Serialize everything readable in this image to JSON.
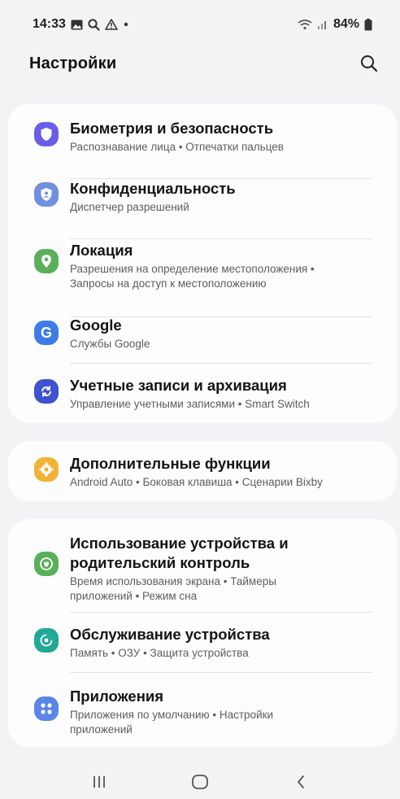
{
  "status_bar": {
    "time": "14:33",
    "battery": "84%",
    "icons_left": [
      "gallery-icon",
      "search-icon",
      "warning-icon",
      "dot-icon"
    ],
    "icons_right": [
      "wifi-icon",
      "signal-icon",
      "battery-icon"
    ]
  },
  "header": {
    "title": "Настройки",
    "search_icon": "search-icon"
  },
  "groups": [
    {
      "items": [
        {
          "title": "Биометрия и безопасность",
          "subtitle": "Распознавание лица • Отпечатки пальцев",
          "icon": "shield-icon",
          "color": "#6a5ee8"
        },
        {
          "title": "Конфиденциальность",
          "subtitle": "Диспетчер разрешений",
          "icon": "privacy-icon",
          "color": "#6f8fe0"
        },
        {
          "title": "Локация",
          "subtitle": "Разрешения на определение местоположения •\nЗапросы на доступ к местоположению",
          "icon": "location-icon",
          "color": "#5aaf5a"
        },
        {
          "title": "Google",
          "subtitle": "Службы Google",
          "icon": "google-icon",
          "color": "#3f7be6"
        },
        {
          "title": "Учетные записи и архивация",
          "subtitle": "Управление учетными записями • Smart Switch",
          "icon": "sync-icon",
          "color": "#3f52cf"
        }
      ]
    },
    {
      "items": [
        {
          "title": "Дополнительные функции",
          "subtitle": "Android Auto • Боковая клавиша • Сценарии Bixby",
          "icon": "gear-plus-icon",
          "color": "#f2b233"
        }
      ]
    },
    {
      "items": [
        {
          "title": "Использование устройства и\nродительский контроль",
          "subtitle": "Время использования экрана • Таймеры\nприложений • Режим сна",
          "icon": "wellbeing-icon",
          "color": "#5aaf5a"
        },
        {
          "title": "Обслуживание устройства",
          "subtitle": "Память • ОЗУ • Защита устройства",
          "icon": "device-care-icon",
          "color": "#21a896"
        },
        {
          "title": "Приложения",
          "subtitle": "Приложения по умолчанию • Настройки\nприложений",
          "icon": "apps-icon",
          "color": "#5c85e8"
        }
      ]
    }
  ],
  "nav_bar": {
    "recents_icon": "recents-icon",
    "home_icon": "home-icon",
    "back_icon": "back-icon"
  }
}
